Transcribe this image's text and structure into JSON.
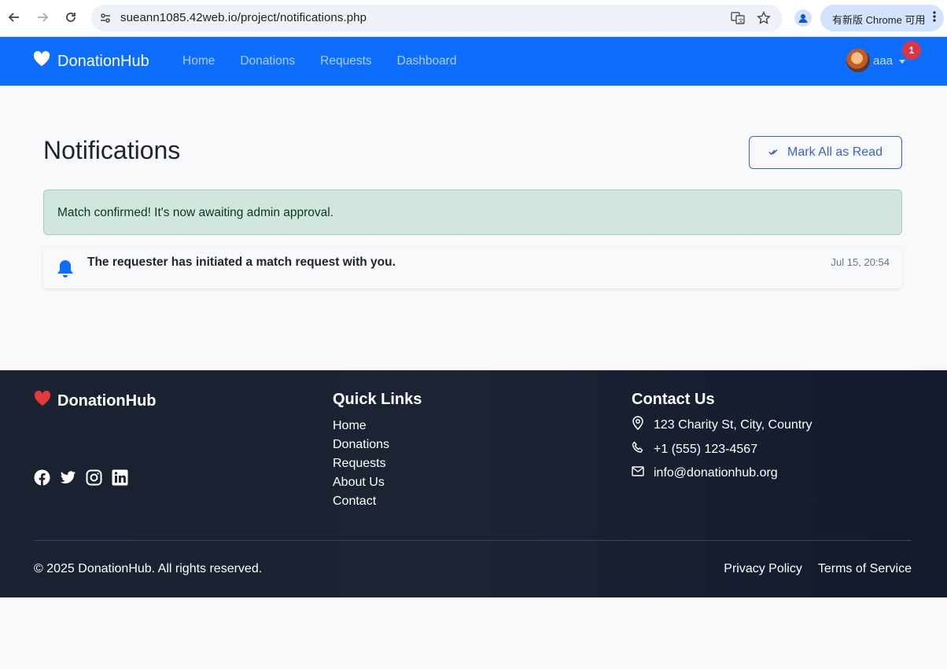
{
  "browser": {
    "url": "sueann1085.42web.io/project/notifications.php",
    "update_label": "有新版 Chrome 可用"
  },
  "navbar": {
    "brand": "DonationHub",
    "links": [
      "Home",
      "Donations",
      "Requests",
      "Dashboard"
    ],
    "username": "aaa",
    "badge_count": "1",
    "colors": {
      "primary": "#0d6efd",
      "badge": "#dc3545"
    }
  },
  "main": {
    "title": "Notifications",
    "mark_all_label": "Mark All as Read",
    "alert": "Match confirmed! It's now awaiting admin approval.",
    "notifications": [
      {
        "message": "The requester has initiated a match request with you.",
        "time": "Jul 15, 20:54"
      }
    ]
  },
  "footer": {
    "brand": "DonationHub",
    "socials": [
      "facebook-icon",
      "twitter-icon",
      "instagram-icon",
      "linkedin-icon"
    ],
    "quick_links_title": "Quick Links",
    "quick_links": [
      "Home",
      "Donations",
      "Requests",
      "About Us",
      "Contact"
    ],
    "contact_title": "Contact Us",
    "contact": {
      "address": "123 Charity St, City, Country",
      "phone": "+1 (555) 123-4567",
      "email": "info@donationhub.org"
    },
    "copyright": "© 2025 DonationHub. All rights reserved.",
    "privacy": "Privacy Policy",
    "terms": "Terms of Service"
  }
}
